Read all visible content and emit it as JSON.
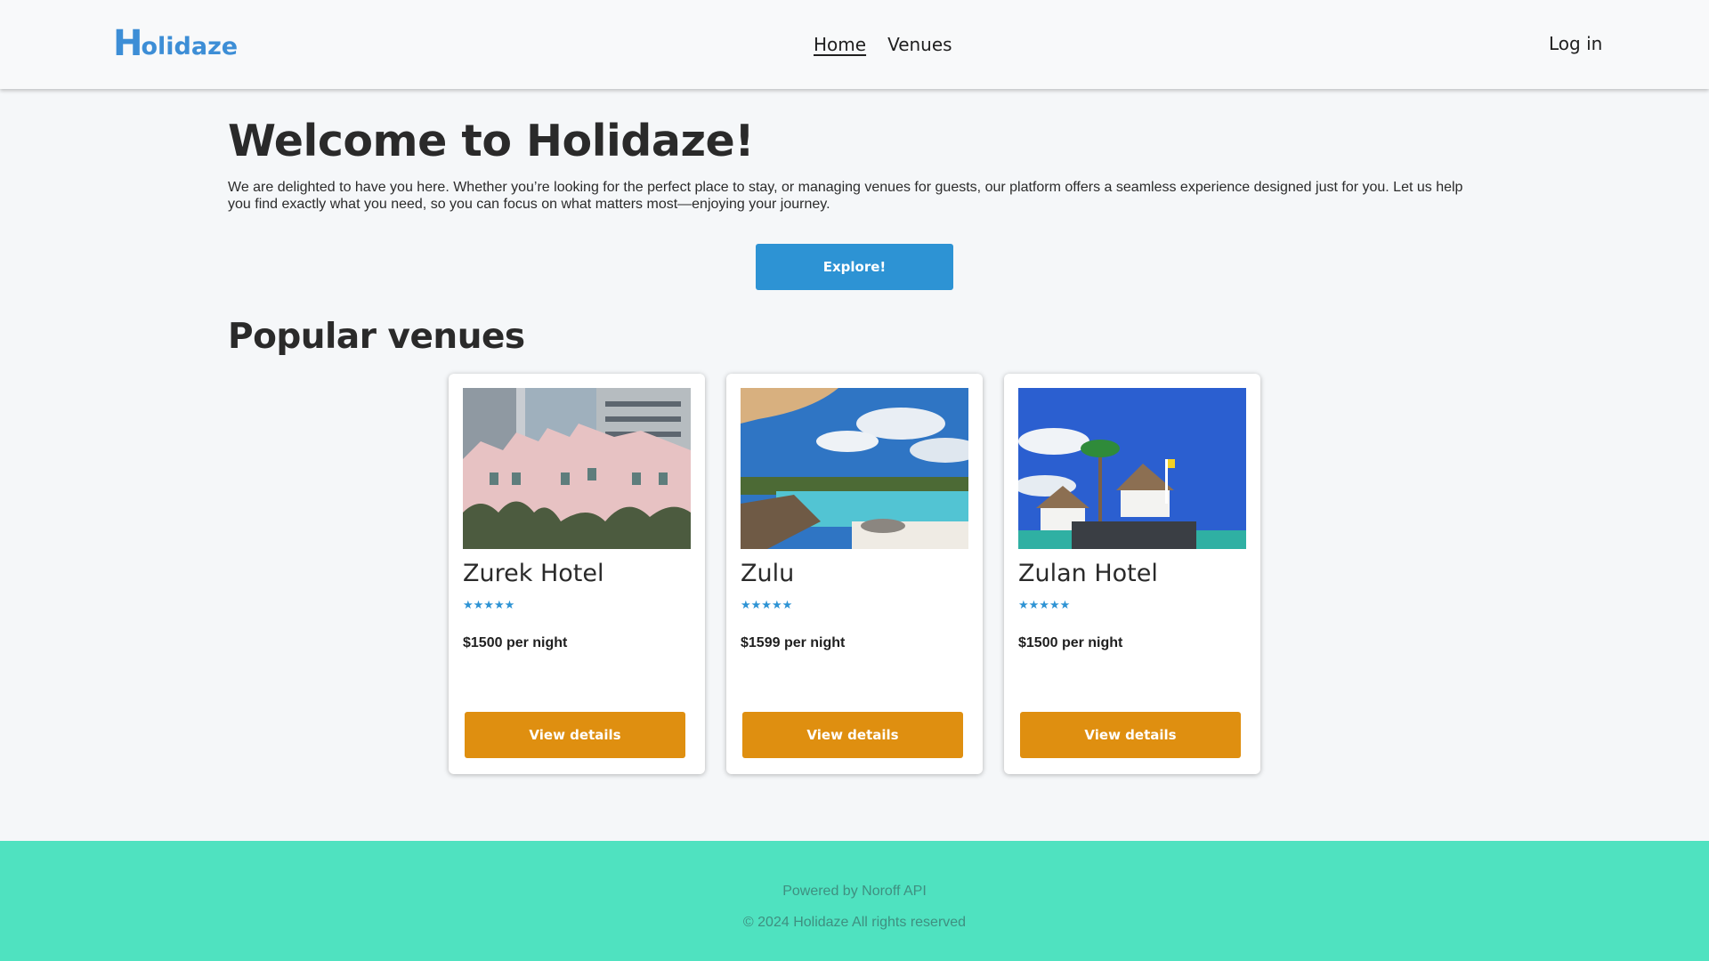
{
  "brand": {
    "logo_first": "H",
    "logo_rest": "olidaze",
    "color": "#3d8ed6"
  },
  "nav": {
    "items": [
      {
        "label": "Home",
        "active": true
      },
      {
        "label": "Venues",
        "active": false
      }
    ],
    "login_label": "Log in"
  },
  "hero": {
    "title": "Welcome to Holidaze!",
    "text": "We are delighted to have you here. Whether you’re looking for the perfect place to stay, or managing venues for guests, our platform offers a seamless experience designed just for you. Let us help you find exactly what you need, so you can focus on what matters most—enjoying your journey.",
    "explore_label": "Explore!"
  },
  "popular": {
    "title": "Popular venues",
    "venues": [
      {
        "name": "Zurek Hotel",
        "rating": 5,
        "stars": "★★★★★",
        "price": "$1500 per night",
        "button": "View details",
        "image": "pink-hotel-photo"
      },
      {
        "name": "Zulu",
        "rating": 5,
        "stars": "★★★★★",
        "price": "$1599 per night",
        "button": "View details",
        "image": "pool-resort-photo"
      },
      {
        "name": "Zulan Hotel",
        "rating": 5,
        "stars": "★★★★★",
        "price": "$1500 per night",
        "button": "View details",
        "image": "tropical-villa-photo"
      }
    ]
  },
  "footer": {
    "powered": "Powered by Noroff API",
    "copyright": "© 2024 Holidaze All rights reserved"
  },
  "colors": {
    "primary": "#2d93d4",
    "accent": "#df8f10",
    "footer_bg": "#4fe2c0"
  }
}
